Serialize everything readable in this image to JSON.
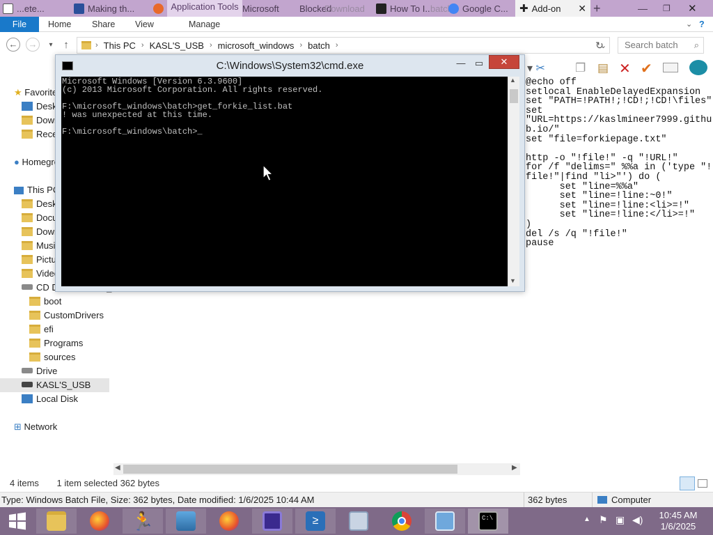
{
  "tabs": [
    {
      "title": "...ete..."
    },
    {
      "title": "Making th..."
    },
    {
      "title": "Microsoft"
    },
    {
      "title": "Blocked"
    },
    {
      "title": "Download"
    },
    {
      "title": "How To I..."
    },
    {
      "title": "batch"
    },
    {
      "title": "Google C..."
    },
    {
      "title": "Add-on"
    }
  ],
  "application_tools": "Application Tools",
  "ribbon": {
    "file": "File",
    "home": "Home",
    "share": "Share",
    "view": "View",
    "manage": "Manage"
  },
  "address": {
    "crumbs": [
      "This PC",
      "KASL'S_USB",
      "microsoft_windows",
      "batch"
    ],
    "search_placeholder": "Search batch"
  },
  "nav": {
    "favorites": "Favorites",
    "desktop": "Desktop",
    "downloads": "Downloads",
    "recent": "Recent places",
    "homegroup": "Homegroup",
    "this_pc": "This PC",
    "desktop2": "Desktop",
    "documents": "Documents",
    "downloads2": "Downloads",
    "music": "Music",
    "pictures": "Pictures",
    "videos": "Videos",
    "cd_drive": "CD Drive - HBCD_",
    "boot": "boot",
    "customdrivers": "CustomDrivers",
    "efi": "efi",
    "programs": "Programs",
    "sources": "sources",
    "drive": "Drive",
    "usb": "KASL'S_USB",
    "local_disk": "Local Disk",
    "network": "Network"
  },
  "preview_text": "@echo off\nsetlocal EnableDelayedExpansion\nset \"PATH=!PATH!;!CD!;!CD!\\files\"\nset\n\"URL=https://kaslmineer7999.githu\nb.io/\"\nset \"file=forkiepage.txt\"\n\nhttp -o \"!file!\" -q \"!URL!\"\nfor /f \"delims=\" %%a in ('type \"!\nfile!\"|find \"li>\"') do (\n      set \"line=%%a\"\n      set \"line=!line:~0!\"\n      set \"line=!line:<li>=!\"\n      set \"line=!line:</li>=!\"\n)\ndel /s /q \"!file!\"\npause",
  "cmd": {
    "title": "C:\\Windows\\System32\\cmd.exe",
    "output": "Microsoft Windows [Version 6.3.9600]\n(c) 2013 Microsoft Corporation. All rights reserved.\n\nF:\\microsoft_windows\\batch>get_forkie_list.bat\n! was unexpected at this time.\n\nF:\\microsoft_windows\\batch>_"
  },
  "status": {
    "items": "4 items",
    "selected": "1 item selected  362 bytes"
  },
  "details": {
    "type_info": "Type: Windows Batch File, Size: 362 bytes, Date modified: 1/6/2025 10:44 AM",
    "size": "362 bytes",
    "location": "Computer"
  },
  "clock": {
    "time": "10:45 AM",
    "date": "1/6/2025"
  }
}
